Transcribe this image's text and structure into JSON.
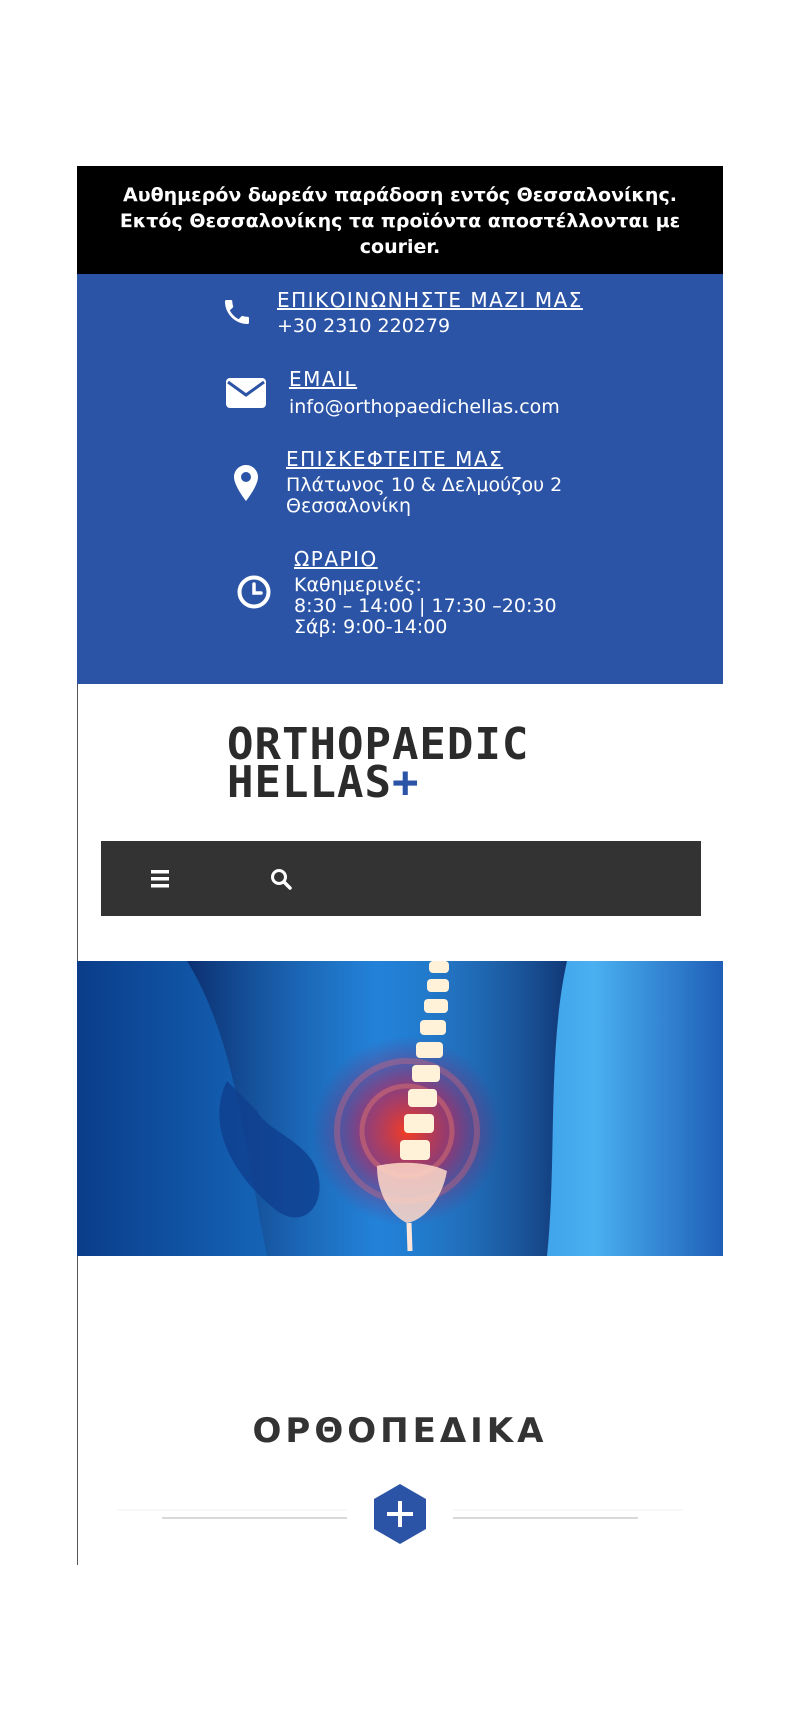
{
  "topbar": {
    "line1": "Αυθημερόν δωρεάν παράδοση εντός Θεσσαλονίκης.",
    "line2": "Εκτός Θεσσαλονίκης τα προϊόντα αποστέλλονται με",
    "line3": "courier."
  },
  "contact": {
    "phone": {
      "heading": "ΕΠΙΚΟΙΝΩΝΗΣΤΕ ΜΑΖΙ ΜΑΣ",
      "value": "+30 2310 220279",
      "icon": "phone-icon"
    },
    "email": {
      "heading": "EMAIL",
      "value": "info@orthopaedichellas.com",
      "icon": "envelope-icon"
    },
    "visit": {
      "heading": "ΕΠΙΣΚΕΦΤΕΙΤΕ ΜΑΣ",
      "line1": "Πλάτωνος 10 & Δελμούζου 2",
      "line2": "Θεσσαλονίκη",
      "icon": "map-pin-icon"
    },
    "hours": {
      "heading": "ΩΡΑΡΙΟ",
      "line1": "Καθημερινές:",
      "line2": "8:30 – 14:00 | 17:30 –20:30",
      "line3": "Σάβ: 9:00-14:00",
      "icon": "clock-icon"
    }
  },
  "logo": {
    "line1": "ORTHOPAEDIC",
    "line2": "HELLAS",
    "plus": "+"
  },
  "nav": {
    "menu_icon": "menu-icon",
    "search_icon": "search-icon"
  },
  "hero": {
    "image": "spine-xray-illustration"
  },
  "section": {
    "title": "ΟΡΘΟΠΕΔΙΚΑ",
    "divider_icon": "plus-hexagon-icon"
  },
  "colors": {
    "accent": "#2c54a6",
    "topbar_bg": "#000000",
    "nav_bg": "#333333"
  }
}
